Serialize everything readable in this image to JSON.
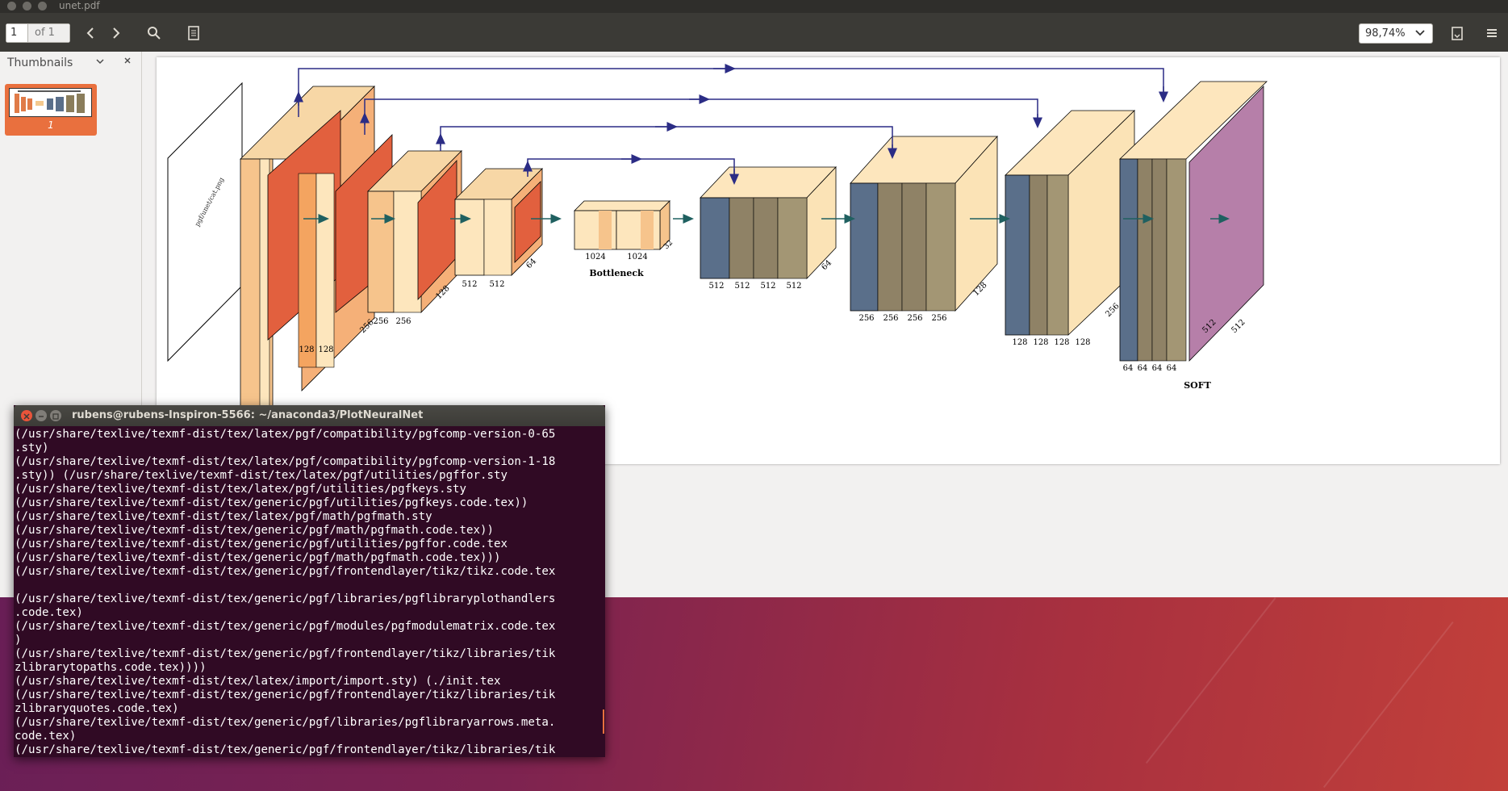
{
  "viewer": {
    "title": "unet.pdf",
    "page_number": "1",
    "page_of": "of 1",
    "zoom": "98,74%",
    "sidebar_title": "Thumbnails",
    "thumbnail_page": "1"
  },
  "diagram": {
    "stack_labels": {
      "e1a": "128",
      "e1b": "128",
      "e2a": "256",
      "e2b": "256",
      "e3a": "512",
      "e3b": "512",
      "bn_a": "1024",
      "bn_b": "1024",
      "bn_c": "32",
      "d3a": "512",
      "d3b": "512",
      "d3c": "512",
      "d3d": "512",
      "d3z": "64",
      "d2a": "256",
      "d2b": "256",
      "d2c": "256",
      "d2d": "256",
      "d2z": "128",
      "d1a": "128",
      "d1b": "128",
      "d1c": "128",
      "d1d": "128",
      "d1z": "256",
      "d0a": "64",
      "d0b": "64",
      "d0c": "64",
      "d0d": "64",
      "d0z": "512",
      "d0y": "512",
      "e3z": "64",
      "e2z": "128",
      "e1z": "256"
    },
    "bottleneck_caption": "Bottleneck",
    "softmax_caption": "SOFT",
    "input_caption": "pgf/unet/cat.png"
  },
  "terminal": {
    "title": "rubens@rubens-Inspiron-5566: ~/anaconda3/PlotNeuralNet",
    "lines": [
      "(/usr/share/texlive/texmf-dist/tex/latex/pgf/compatibility/pgfcomp-version-0-65",
      ".sty)",
      "(/usr/share/texlive/texmf-dist/tex/latex/pgf/compatibility/pgfcomp-version-1-18",
      ".sty)) (/usr/share/texlive/texmf-dist/tex/latex/pgf/utilities/pgffor.sty",
      "(/usr/share/texlive/texmf-dist/tex/latex/pgf/utilities/pgfkeys.sty",
      "(/usr/share/texlive/texmf-dist/tex/generic/pgf/utilities/pgfkeys.code.tex))",
      "(/usr/share/texlive/texmf-dist/tex/latex/pgf/math/pgfmath.sty",
      "(/usr/share/texlive/texmf-dist/tex/generic/pgf/math/pgfmath.code.tex))",
      "(/usr/share/texlive/texmf-dist/tex/generic/pgf/utilities/pgffor.code.tex",
      "(/usr/share/texlive/texmf-dist/tex/generic/pgf/math/pgfmath.code.tex)))",
      "(/usr/share/texlive/texmf-dist/tex/generic/pgf/frontendlayer/tikz/tikz.code.tex",
      "",
      "(/usr/share/texlive/texmf-dist/tex/generic/pgf/libraries/pgflibraryplothandlers",
      ".code.tex)",
      "(/usr/share/texlive/texmf-dist/tex/generic/pgf/modules/pgfmodulematrix.code.tex",
      ")",
      "(/usr/share/texlive/texmf-dist/tex/generic/pgf/frontendlayer/tikz/libraries/tik",
      "zlibrarytopaths.code.tex))))",
      "(/usr/share/texlive/texmf-dist/tex/latex/import/import.sty) (./init.tex",
      "(/usr/share/texlive/texmf-dist/tex/generic/pgf/frontendlayer/tikz/libraries/tik",
      "zlibraryquotes.code.tex)",
      "(/usr/share/texlive/texmf-dist/tex/generic/pgf/libraries/pgflibraryarrows.meta.",
      "code.tex)",
      "(/usr/share/texlive/texmf-dist/tex/generic/pgf/frontendlayer/tikz/libraries/tik"
    ]
  }
}
